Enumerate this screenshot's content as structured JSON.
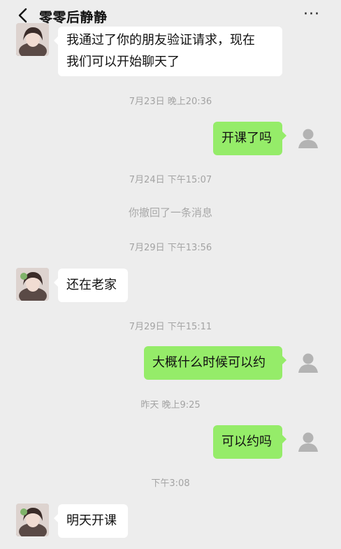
{
  "header": {
    "title": "零零后静静",
    "back_icon": "chevron-left-icon",
    "more_icon": "more-dots-icon",
    "more_text": "···"
  },
  "messages": [
    {
      "type": "received",
      "text_line1": "我通过了你的朋友验证请求，现在",
      "text_line2": "我们可以开始聊天了"
    },
    {
      "type": "time",
      "text": "7月23日 晚上20:36"
    },
    {
      "type": "sent",
      "text": "开课了吗"
    },
    {
      "type": "time",
      "text": "7月24日 下午15:07"
    },
    {
      "type": "system",
      "text": "你撤回了一条消息"
    },
    {
      "type": "time",
      "text": "7月29日 下午13:56"
    },
    {
      "type": "received",
      "text": "还在老家"
    },
    {
      "type": "time",
      "text": "7月29日 下午15:11"
    },
    {
      "type": "sent",
      "text": "大概什么时候可以约"
    },
    {
      "type": "time",
      "text": "昨天 晚上9:25"
    },
    {
      "type": "sent",
      "text": "可以约吗"
    },
    {
      "type": "time",
      "text": "下午3:08"
    },
    {
      "type": "received",
      "text": "明天开课"
    }
  ],
  "colors": {
    "background": "#ededed",
    "sent_bubble": "#95ec69",
    "received_bubble": "#ffffff",
    "timestamp": "#a3a3a3"
  }
}
